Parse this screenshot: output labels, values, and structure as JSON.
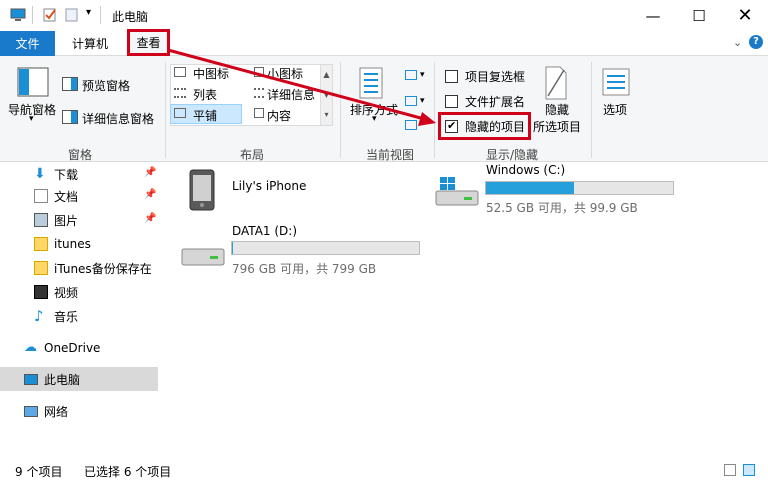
{
  "titlebar": {
    "title": "此电脑"
  },
  "tabs": {
    "file": "文件",
    "computer": "计算机",
    "view": "查看"
  },
  "ribbon": {
    "pane_group": {
      "nav_pane": "导航窗格",
      "preview_pane": "预览窗格",
      "details_pane": "详细信息窗格",
      "label": "窗格"
    },
    "layout_group": {
      "medium_icons": "中图标",
      "small_icons": "小图标",
      "list": "列表",
      "details": "详细信息",
      "tiles": "平铺",
      "content": "内容",
      "label": "布局"
    },
    "view_group": {
      "sort_by": "排序方式",
      "label": "当前视图"
    },
    "show_group": {
      "item_checkboxes": {
        "label": "项目复选框",
        "checked": false
      },
      "file_extensions": {
        "label": "文件扩展名",
        "checked": false
      },
      "hidden_items": {
        "label": "隐藏的项目",
        "checked": true
      },
      "hide_selected_line1": "隐藏",
      "hide_selected_line2": "所选项目",
      "label": "显示/隐藏"
    },
    "options": "选项"
  },
  "nav": {
    "quick": [
      {
        "label": "下载",
        "icon": "download-icon",
        "pinned": true
      },
      {
        "label": "文档",
        "icon": "document-icon",
        "pinned": true
      },
      {
        "label": "图片",
        "icon": "picture-icon",
        "pinned": true
      },
      {
        "label": "itunes",
        "icon": "folder-icon",
        "pinned": false
      },
      {
        "label": "iTunes备份保存在",
        "icon": "folder-icon",
        "pinned": false
      },
      {
        "label": "视频",
        "icon": "video-icon",
        "pinned": false
      },
      {
        "label": "音乐",
        "icon": "music-icon",
        "pinned": false
      }
    ],
    "onedrive": "OneDrive",
    "this_pc": "此电脑",
    "network": "网络"
  },
  "devices": [
    {
      "name": "Lily's iPhone"
    },
    {
      "name": "Windows (C:)",
      "info": "52.5 GB 可用，共 99.9 GB",
      "used_fraction": 0.47
    },
    {
      "name": "DATA1 (D:)",
      "info": "796 GB 可用，共 799 GB",
      "used_fraction": 0.004
    }
  ],
  "status": {
    "count": "9 个项目",
    "selected": "已选择 6 个项目"
  },
  "colors": {
    "accent": "#1979ca",
    "bar_fill": "#26a0da",
    "highlight": "#d0021b"
  }
}
